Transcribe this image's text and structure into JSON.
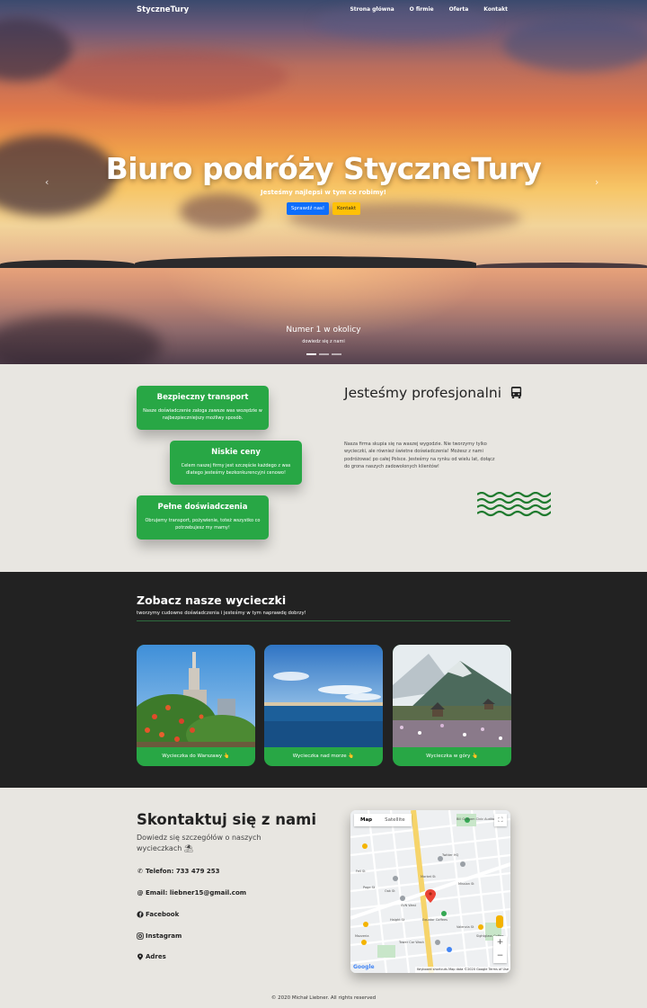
{
  "navbar": {
    "brand": "StyczneTury",
    "links": [
      "Strona główna",
      "O firmie",
      "Oferta",
      "Kontakt"
    ]
  },
  "hero": {
    "title": "Biuro podróży StyczneTury",
    "subtitle": "Jesteśmy najlepsi w tym co robimy!",
    "btn_primary": "Sprawdź nas!",
    "btn_secondary": "Kontakt",
    "caption_title": "Numer 1 w okolicy",
    "caption_text": "dowiedz się z nami",
    "slides_total": 3,
    "active_slide": 1
  },
  "features": {
    "cards": [
      {
        "title": "Bezpieczny transport",
        "text": "Nasze doświadczenie zaloga zawsze was wozędzie w najbezpieczniejszy możliwy sposób."
      },
      {
        "title": "Niskie ceny",
        "text": "Celem naszej firmy jest szczęście każdego z was dlatego jesteśmy bezkonkurencyjni cenowo!"
      },
      {
        "title": "Pełne doświadczenia",
        "text": "Obrujemy transport, pożywienie, toteż wszystko co potrzebujesz my mamy!"
      }
    ],
    "pro_title": "Jesteśmy profesjonalni",
    "pro_text": "Nasza firma skupia się na waszej wygodzie. Nie tworzymy tylko wycieczki, ale również świetne doświadczenia! Możesz z nami podróżować po całej Polsce. Jesteśmy na rynku od wielu lat, dołącz do grona naszych zadowolonych klientów!"
  },
  "trips": {
    "title": "Zobacz nasze wycieczki",
    "subtitle": "tworzymy cudowne doświadczenia i jesteśmy w tym naprawdę dobrzy!",
    "cards": [
      {
        "label": "Wycieczka do Warszawy 👆"
      },
      {
        "label": "Wycieczka nad morze 👆"
      },
      {
        "label": "Wycieczka w góry 👆"
      }
    ]
  },
  "contact": {
    "title": "Skontaktuj się z nami",
    "subtitle": "Dowiedz się szczegółów o naszych wycieczkach ⛱",
    "phone": "Telefon: 733 479 253",
    "email": "Email: liebner15@gmail.com",
    "facebook": "Facebook",
    "instagram": "Instagram",
    "address": "Adres"
  },
  "map": {
    "tab_map": "Map",
    "tab_satellite": "Satellite",
    "zoom_in": "+",
    "zoom_out": "−",
    "google": "Google",
    "footer": "Keyboard shortcuts   Map data ©2020 Google   Terms of Use",
    "labels": [
      "Bill Graham Civic Auditorium",
      "Twitter HQ",
      "SVN West",
      "Mission St",
      "Fell St",
      "Oak St",
      "Page St",
      "Haight St",
      "Market St",
      "Valencia St",
      "Equator Coffees",
      "Mozzeria",
      "Tower Car Wash",
      "Sightglass Coffee"
    ]
  },
  "footer": {
    "text": "© 2020 Michał Liebner. All rights reserved"
  },
  "colors": {
    "green": "#28a745",
    "dark": "#222222",
    "light_bg": "#e8e6e1",
    "blue_btn": "#0d6efd",
    "yellow_btn": "#ffc107"
  },
  "icons": {
    "bus": "bus-icon",
    "phone": "phone-icon",
    "email": "at-icon",
    "facebook": "facebook-icon",
    "instagram": "instagram-icon",
    "address": "map-marker-icon"
  }
}
